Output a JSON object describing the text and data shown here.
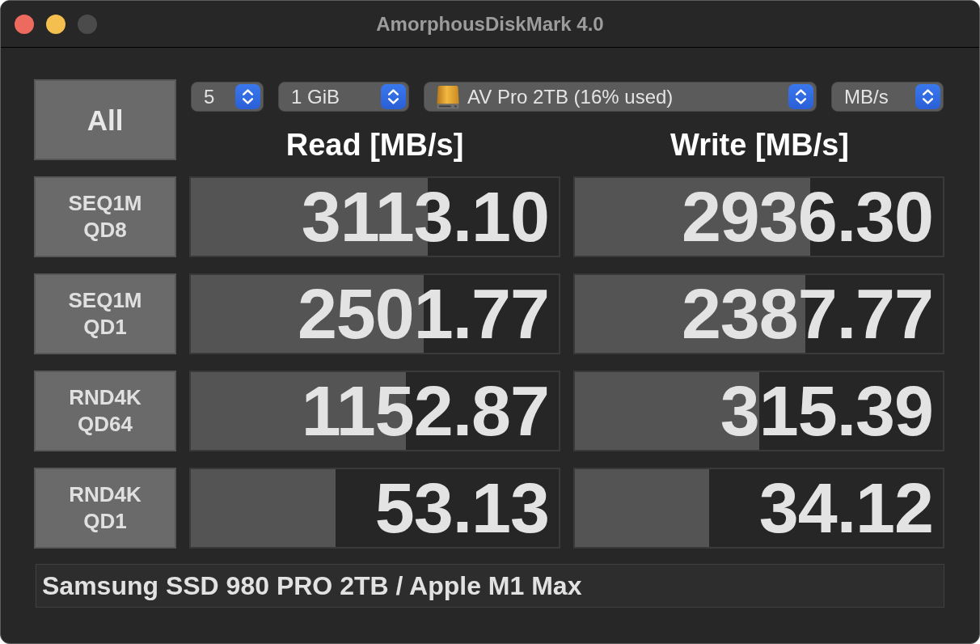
{
  "window": {
    "title": "AmorphousDiskMark 4.0",
    "zoom_disabled": true
  },
  "toolbar": {
    "all_button": "All",
    "selects": [
      {
        "kind": "plain",
        "value": "5"
      },
      {
        "kind": "plain",
        "value": "1 GiB"
      },
      {
        "kind": "drive",
        "value": "AV Pro 2TB (16% used)"
      },
      {
        "kind": "plain",
        "value": "MB/s"
      }
    ]
  },
  "columns": [
    "Read [MB/s]",
    "Write [MB/s]"
  ],
  "rows": [
    {
      "label": [
        "SEQ1M",
        "QD8"
      ],
      "read": {
        "reading": "3113.10",
        "level": 0.645
      },
      "write": {
        "reading": "2936.30",
        "level": 0.64
      }
    },
    {
      "label": [
        "SEQ1M",
        "QD1"
      ],
      "read": {
        "reading": "2501.77",
        "level": 0.632
      },
      "write": {
        "reading": "2387.77",
        "level": 0.627
      }
    },
    {
      "label": [
        "RND4K",
        "QD64"
      ],
      "read": {
        "reading": "1152.87",
        "level": 0.584
      },
      "write": {
        "reading": "315.39",
        "level": 0.5
      }
    },
    {
      "label": [
        "RND4K",
        "QD1"
      ],
      "read": {
        "reading": "53.13",
        "level": 0.394
      },
      "write": {
        "reading": "34.12",
        "level": 0.365
      }
    }
  ],
  "comment": "Samsung SSD 980 PRO 2TB / Apple M1 Max"
}
